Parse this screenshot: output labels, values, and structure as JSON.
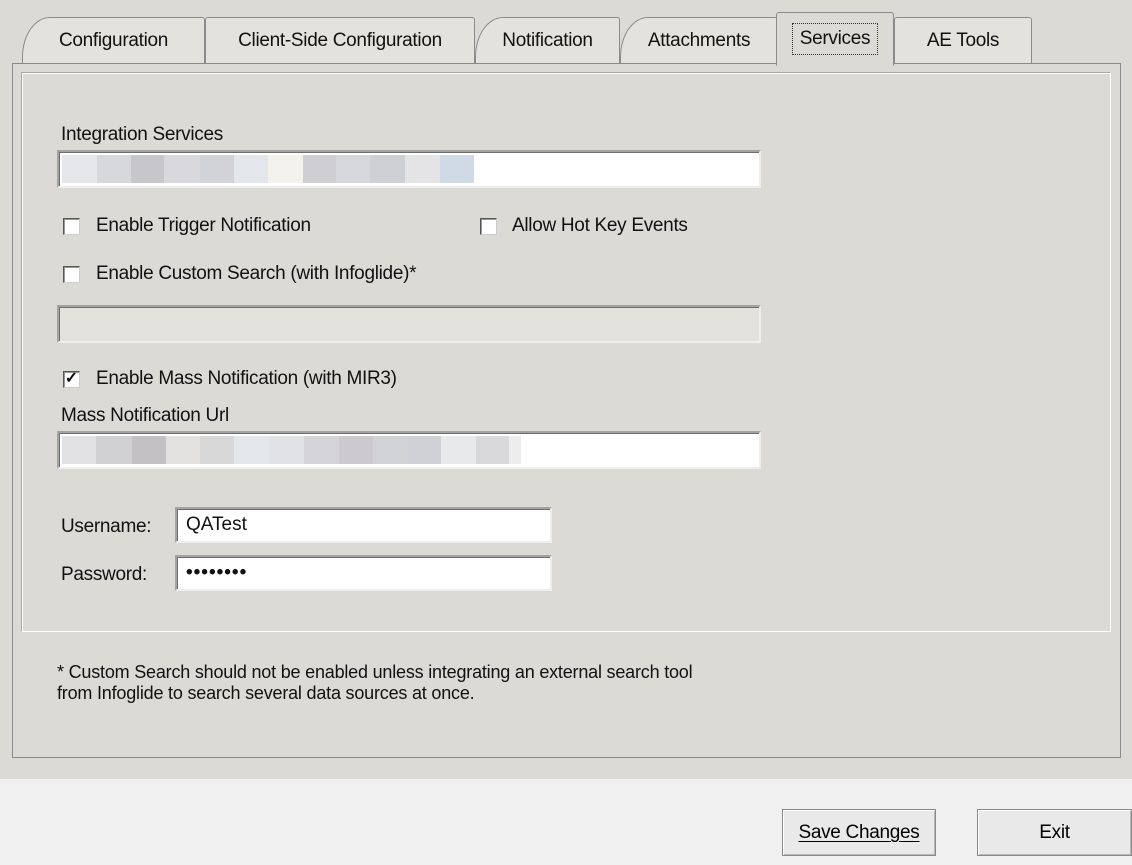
{
  "tabs": [
    {
      "label": "Configuration"
    },
    {
      "label": "Client-Side Configuration"
    },
    {
      "label": "Notification"
    },
    {
      "label": "Attachments"
    },
    {
      "label": "Services"
    },
    {
      "label": "AE Tools"
    }
  ],
  "active_tab": "Services",
  "services": {
    "integration_label": "Integration Services",
    "integration_value": "",
    "enable_trigger_label": "Enable Trigger Notification",
    "enable_trigger_checked": false,
    "allow_hotkey_label": "Allow Hot Key Events",
    "allow_hotkey_checked": false,
    "custom_search_label": "Enable Custom Search (with Infoglide)*",
    "custom_search_checked": false,
    "custom_search_value": "",
    "mass_notification_label": "Enable Mass Notification (with MIR3)",
    "mass_notification_checked": true,
    "mass_url_label": "Mass Notification Url",
    "mass_url_value": "",
    "username_label": "Username:",
    "username_value": "QATest",
    "password_label": "Password:",
    "password_value": "••••••••",
    "footnote_line1": "* Custom Search should not be enabled unless integrating an external search tool",
    "footnote_line2": "from Infoglide to search several data sources at once."
  },
  "buttons": {
    "save_label": "Save Changes",
    "exit_label": "Exit"
  },
  "colors": {
    "panel_bg": "#dcdad5",
    "bar_bg": "#f0f0f0"
  }
}
